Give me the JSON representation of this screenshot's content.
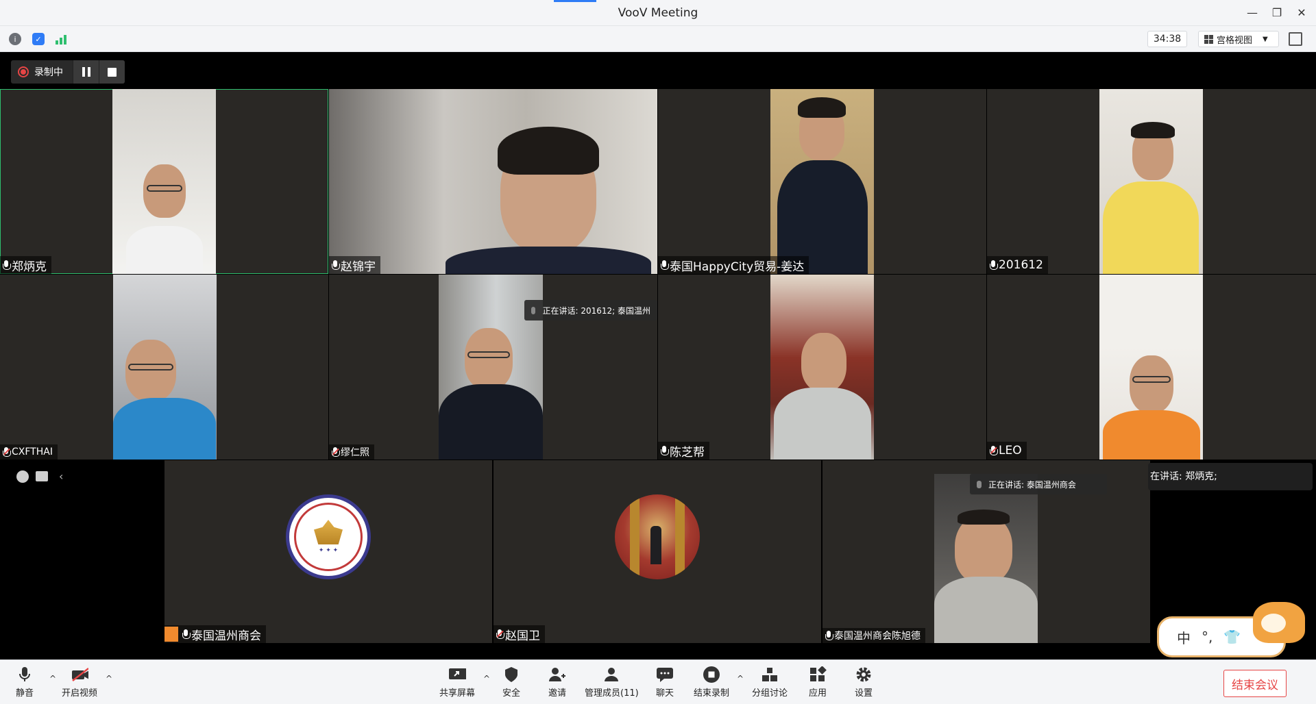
{
  "window": {
    "title": "VooV Meeting"
  },
  "infobar": {
    "timer": "34:38",
    "view_mode": "宫格视图"
  },
  "recording": {
    "label": "录制中"
  },
  "participants": [
    {
      "name": "郑炳克"
    },
    {
      "name": "赵锦宇"
    },
    {
      "name": "泰国HappyCity贸易-姜达"
    },
    {
      "name": "201612"
    },
    {
      "name": "CXFTHAI"
    },
    {
      "name": "缪仁照"
    },
    {
      "name": "陈芝帮"
    },
    {
      "name": "LEO"
    },
    {
      "name": "泰国温州商会"
    },
    {
      "name": "赵国卫"
    },
    {
      "name": "泰国温州商会陈旭德"
    }
  ],
  "speaking_tips": {
    "tile_6": "正在讲话: 201612; 泰国温州",
    "tile_11": "正在讲话: 泰国温州商会",
    "banner": "在讲话: 郑炳克;"
  },
  "ime": {
    "mode": "中",
    "punct": "°,"
  },
  "toolbar": {
    "mute": "静音",
    "video": "开启视频",
    "share": "共享屏幕",
    "security": "安全",
    "invite": "邀请",
    "members": "管理成员(11)",
    "chat": "聊天",
    "end_record": "结束录制",
    "breakout": "分组讨论",
    "apps": "应用",
    "settings": "设置",
    "end_meeting": "结束会议"
  },
  "colors": {
    "record_red": "#e64545",
    "active_speaker_border": "#2fbf6f",
    "end_button": "#e64545"
  }
}
